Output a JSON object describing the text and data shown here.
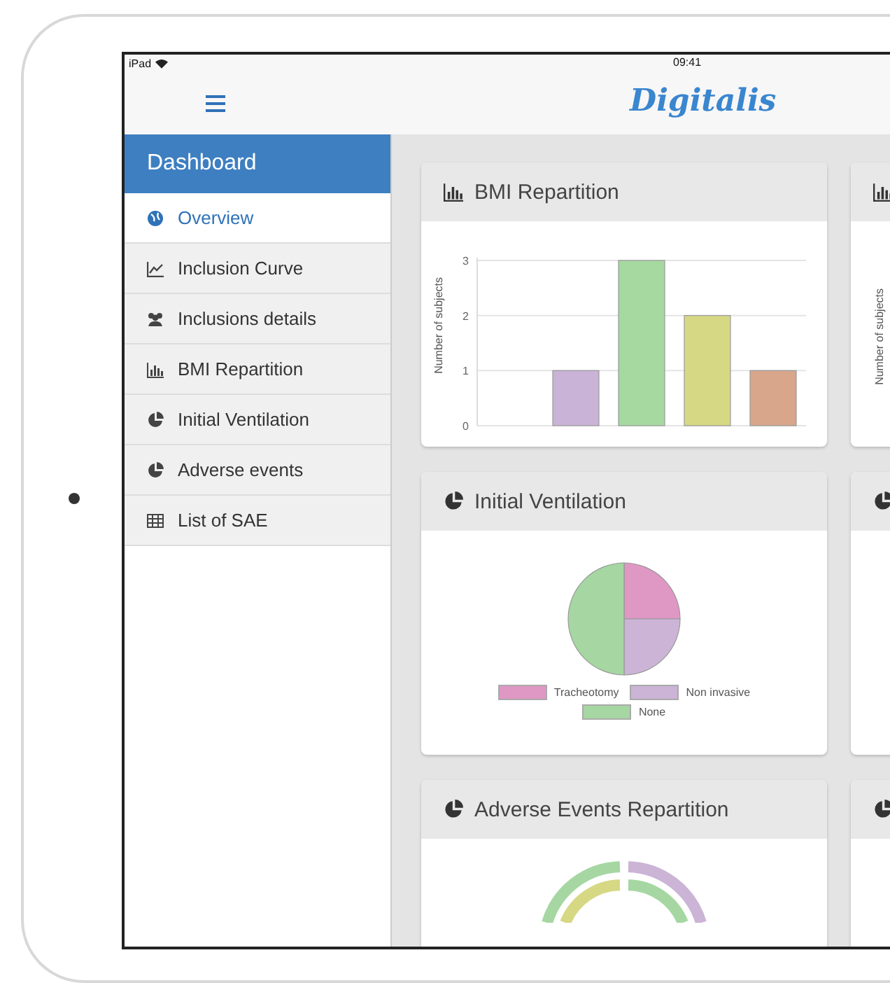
{
  "status_bar": {
    "device": "iPad",
    "time": "09:41"
  },
  "header": {
    "logo": "Digitalis"
  },
  "sidebar": {
    "title": "Dashboard",
    "items": [
      {
        "label": "Overview",
        "selected": true
      },
      {
        "label": "Inclusion Curve",
        "selected": false
      },
      {
        "label": "Inclusions details",
        "selected": false
      },
      {
        "label": "BMI Repartition",
        "selected": false
      },
      {
        "label": "Initial Ventilation",
        "selected": false
      },
      {
        "label": "Adverse events",
        "selected": false
      },
      {
        "label": "List of SAE",
        "selected": false
      }
    ]
  },
  "cards": [
    {
      "title": "BMI Repartition",
      "kind": "bar",
      "chart_data": {
        "type": "bar",
        "ylabel": "Number of subjects",
        "values": [
          0,
          1,
          3,
          2,
          1
        ],
        "colors": [
          "#c9b3d6",
          "#c9b3d6",
          "#a6d9a0",
          "#d6d884",
          "#d8a68a"
        ],
        "ylim": [
          0,
          3
        ],
        "yticks": [
          0,
          1,
          2,
          3
        ]
      }
    },
    {
      "title": "Initial Ventilation",
      "kind": "pie",
      "chart_data": {
        "type": "pie",
        "categories": [
          "Tracheotomy",
          "Non invasive",
          "None"
        ],
        "values": [
          25,
          25,
          50
        ],
        "legend": "bottom",
        "colors": [
          "#df97c4",
          "#cbb4d6",
          "#a6d7a2"
        ]
      }
    },
    {
      "title": "Adverse Events Repartition",
      "kind": "donut"
    }
  ],
  "side_cards": [
    {
      "kind": "bar",
      "ylabel": "Number of subjects"
    },
    {
      "kind": "pie"
    },
    {
      "kind": "pie"
    }
  ]
}
